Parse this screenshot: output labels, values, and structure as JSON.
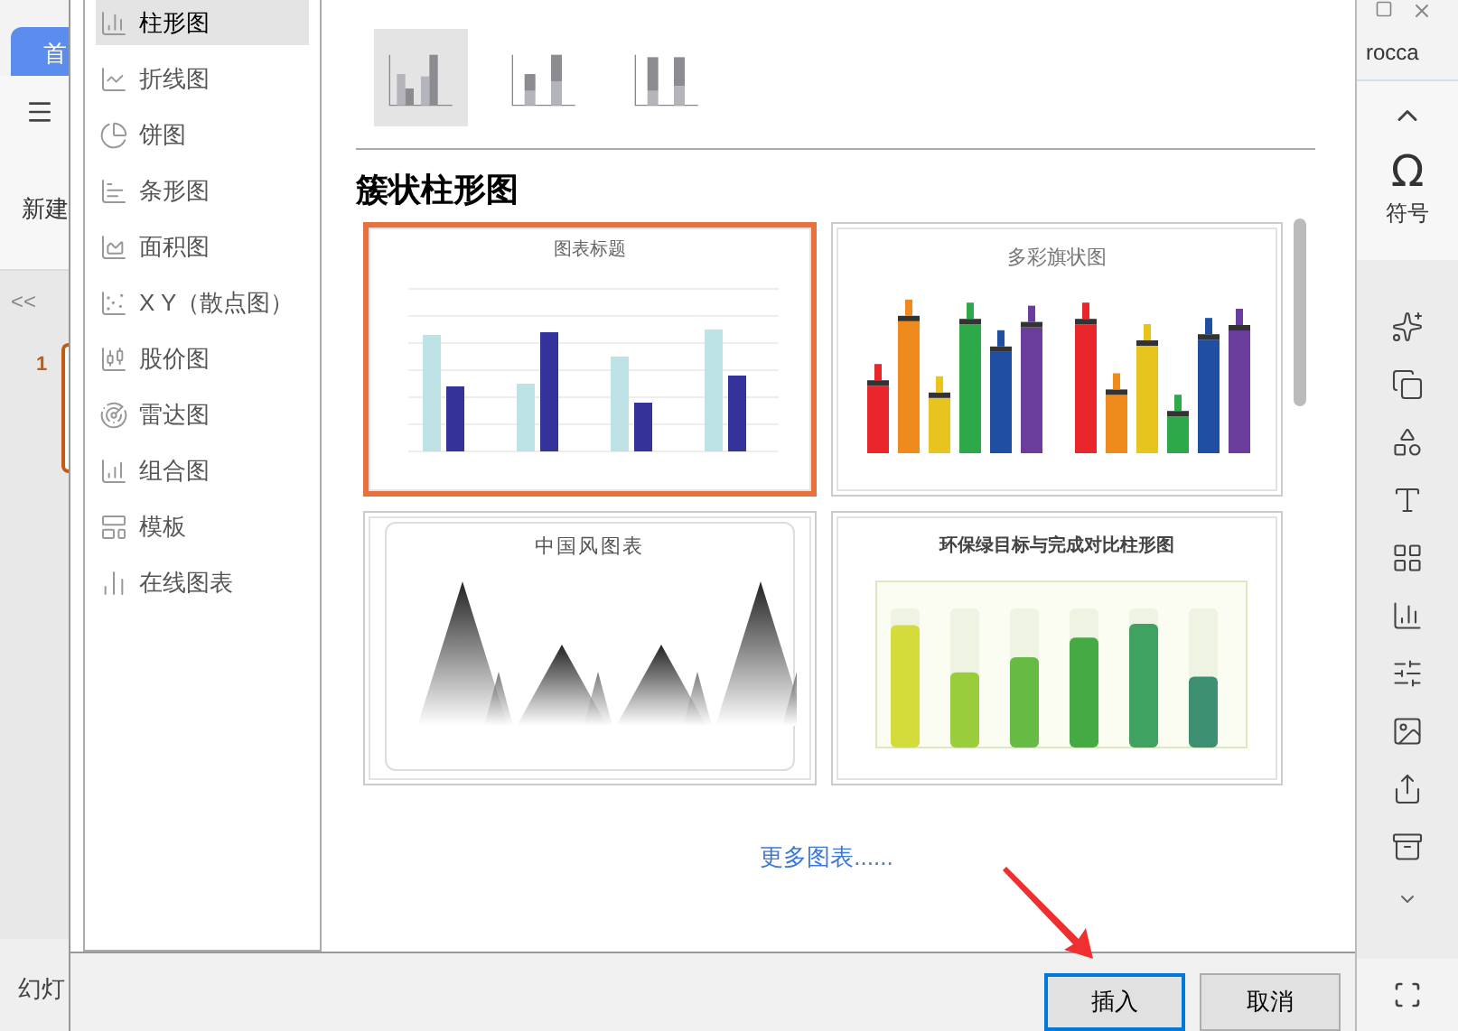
{
  "app_left": {
    "tab": "首",
    "new_label": "新建",
    "collapse": "<<",
    "slide_number": "1",
    "status": "幻灯"
  },
  "app_right": {
    "user": "rocca",
    "symbol_icon": "Ω",
    "symbol_label": "符号"
  },
  "dialog": {
    "categories": [
      {
        "label": "柱形图",
        "selected": true
      },
      {
        "label": "折线图",
        "selected": false
      },
      {
        "label": "饼图",
        "selected": false
      },
      {
        "label": "条形图",
        "selected": false
      },
      {
        "label": "面积图",
        "selected": false
      },
      {
        "label": "X Y（散点图）",
        "selected": false
      },
      {
        "label": "股价图",
        "selected": false
      },
      {
        "label": "雷达图",
        "selected": false
      },
      {
        "label": "组合图",
        "selected": false
      },
      {
        "label": "模板",
        "selected": false
      },
      {
        "label": "在线图表",
        "selected": false
      }
    ],
    "subtypes": [
      {
        "kind": "clustered",
        "selected": true
      },
      {
        "kind": "stacked",
        "selected": false
      },
      {
        "kind": "percent",
        "selected": false
      }
    ],
    "heading": "簇状柱形图",
    "templates": [
      {
        "kind": "basic",
        "title": "图表标题",
        "selected": true
      },
      {
        "kind": "paint",
        "title": "多彩旗状图",
        "selected": false
      },
      {
        "kind": "ink",
        "title": "中国风图表",
        "selected": false
      },
      {
        "kind": "green",
        "title": "环保绿目标与完成对比柱形图",
        "selected": false
      }
    ],
    "more_link": "更多图表......",
    "buttons": [
      {
        "label": "插入",
        "focused": true
      },
      {
        "label": "取消",
        "focused": false
      }
    ]
  }
}
